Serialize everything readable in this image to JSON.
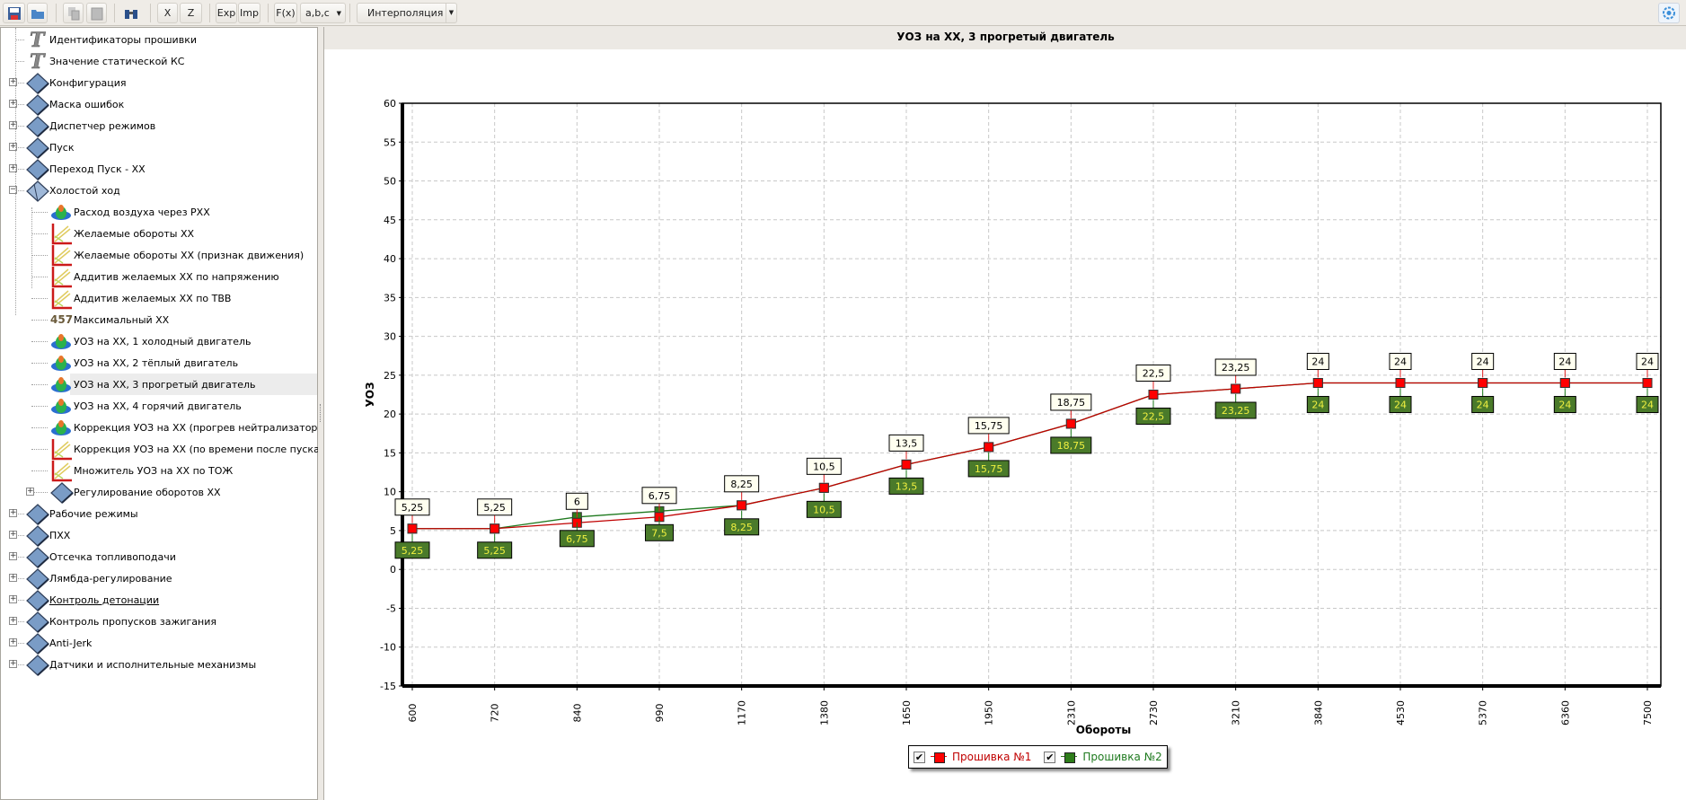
{
  "toolbar": {
    "x": "X",
    "z": "Z",
    "exp": "Exp",
    "imp": "Imp",
    "fx": "F(x)",
    "abc": "a,b,c",
    "mode": "Интерполяция"
  },
  "tree": [
    {
      "label": "Идентификаторы прошивки",
      "level": 0,
      "icon": "text-icon",
      "expander": ""
    },
    {
      "label": "Значение статической КС",
      "level": 0,
      "icon": "text-icon",
      "expander": ""
    },
    {
      "label": "Конфигурация",
      "level": 0,
      "icon": "folder-icon",
      "expander": "+"
    },
    {
      "label": "Маска ошибок",
      "level": 0,
      "icon": "folder-icon",
      "expander": "+"
    },
    {
      "label": "Диспетчер режимов",
      "level": 0,
      "icon": "folder-icon",
      "expander": "+"
    },
    {
      "label": "Пуск",
      "level": 0,
      "icon": "folder-icon",
      "expander": "+"
    },
    {
      "label": "Переход Пуск - ХХ",
      "level": 0,
      "icon": "folder-icon",
      "expander": "+"
    },
    {
      "label": "Холостой ход",
      "level": 0,
      "icon": "folder-open-icon",
      "expander": "−"
    },
    {
      "label": "Расход воздуха через РХХ",
      "level": 1,
      "icon": "surface-icon",
      "expander": ""
    },
    {
      "label": "Желаемые обороты ХХ",
      "level": 1,
      "icon": "curve-icon",
      "expander": ""
    },
    {
      "label": "Желаемые обороты ХХ (признак движения)",
      "level": 1,
      "icon": "curve-icon",
      "expander": ""
    },
    {
      "label": "Аддитив желаемых ХХ по напряжению",
      "level": 1,
      "icon": "curve-icon",
      "expander": ""
    },
    {
      "label": "Аддитив желаемых ХХ по ТВВ",
      "level": 1,
      "icon": "curve-icon",
      "expander": ""
    },
    {
      "label": "Максимальный ХХ",
      "level": 1,
      "icon": "constant-icon",
      "expander": ""
    },
    {
      "label": "УОЗ на ХХ, 1 холодный двигатель",
      "level": 1,
      "icon": "surface-icon",
      "expander": ""
    },
    {
      "label": "УОЗ на ХХ, 2 тёплый двигатель",
      "level": 1,
      "icon": "surface-icon",
      "expander": ""
    },
    {
      "label": "УОЗ на ХХ, 3 прогретый двигатель",
      "level": 1,
      "icon": "surface-icon",
      "expander": "",
      "selected": true
    },
    {
      "label": "УОЗ на ХХ, 4 горячий двигатель",
      "level": 1,
      "icon": "surface-icon",
      "expander": ""
    },
    {
      "label": "Коррекция УОЗ на ХХ (прогрев нейтрализатора)",
      "level": 1,
      "icon": "surface-icon",
      "expander": ""
    },
    {
      "label": "Коррекция УОЗ на ХХ (по времени после пуска)",
      "level": 1,
      "icon": "curve-icon",
      "expander": ""
    },
    {
      "label": "Множитель УОЗ на ХХ по ТОЖ",
      "level": 1,
      "icon": "curve-icon",
      "expander": ""
    },
    {
      "label": "Регулирование оборотов ХХ",
      "level": 1,
      "icon": "folder-icon",
      "expander": "+"
    },
    {
      "label": "Рабочие режимы",
      "level": 0,
      "icon": "folder-icon",
      "expander": "+"
    },
    {
      "label": "ПХХ",
      "level": 0,
      "icon": "folder-icon",
      "expander": "+"
    },
    {
      "label": "Отсечка топливоподачи",
      "level": 0,
      "icon": "folder-icon",
      "expander": "+"
    },
    {
      "label": "Лямбда-регулирование",
      "level": 0,
      "icon": "folder-icon",
      "expander": "+"
    },
    {
      "label": "Контроль детонации",
      "level": 0,
      "icon": "folder-icon",
      "expander": "+",
      "underline": true
    },
    {
      "label": "Контроль пропусков зажигания",
      "level": 0,
      "icon": "folder-icon",
      "expander": "+"
    },
    {
      "label": "Anti-Jerk",
      "level": 0,
      "icon": "folder-icon",
      "expander": "+"
    },
    {
      "label": "Датчики и исполнительные механизмы",
      "level": 0,
      "icon": "folder-icon",
      "expander": "+"
    }
  ],
  "chart_data": {
    "type": "line",
    "title": "УОЗ на ХХ, 3 прогретый двигатель",
    "xlabel": "Обороты",
    "ylabel": "УОЗ",
    "categories": [
      "600",
      "720",
      "840",
      "990",
      "1170",
      "1380",
      "1650",
      "1950",
      "2310",
      "2730",
      "3210",
      "3840",
      "4530",
      "5370",
      "6360",
      "7500"
    ],
    "ylim": [
      -15,
      60
    ],
    "yticks": [
      -15,
      -10,
      -5,
      0,
      5,
      10,
      15,
      20,
      25,
      30,
      35,
      40,
      45,
      50,
      55,
      60
    ],
    "grid": true,
    "legend": "bottom-center",
    "series": [
      {
        "name": "Прошивка №1",
        "color": "#ff0000",
        "line": "#c00000",
        "labels": [
          "5,25",
          "5,25",
          "6",
          "6,75",
          "8,25",
          "10,5",
          "13,5",
          "15,75",
          "18,75",
          "22,5",
          "23,25",
          "24",
          "24",
          "24",
          "24",
          "24"
        ],
        "values": [
          5.25,
          5.25,
          6,
          6.75,
          8.25,
          10.5,
          13.5,
          15.75,
          18.75,
          22.5,
          23.25,
          24,
          24,
          24,
          24,
          24
        ]
      },
      {
        "name": "Прошивка №2",
        "color": "#2e7d1a",
        "line": "#1f7a1f",
        "labels": [
          "5,25",
          "5,25",
          "6,75",
          "7,5",
          "8,25",
          "10,5",
          "13,5",
          "15,75",
          "18,75",
          "22,5",
          "23,25",
          "24",
          "24",
          "24",
          "24",
          "24"
        ],
        "values": [
          5.25,
          5.25,
          6.75,
          7.5,
          8.25,
          10.5,
          13.5,
          15.75,
          18.75,
          22.5,
          23.25,
          24,
          24,
          24,
          24,
          24
        ]
      }
    ]
  }
}
